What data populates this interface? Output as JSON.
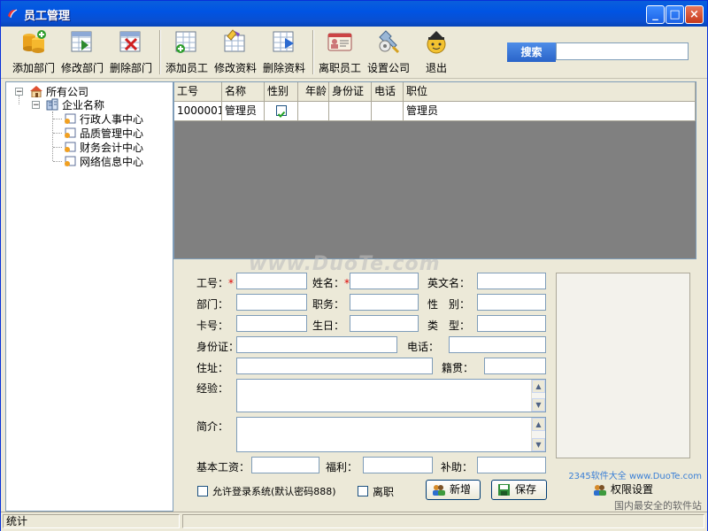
{
  "window": {
    "title": "员工管理"
  },
  "toolbar": {
    "buttons": [
      {
        "label": "添加部门",
        "icon": "add-dept-icon"
      },
      {
        "label": "修改部门",
        "icon": "edit-dept-icon"
      },
      {
        "label": "删除部门",
        "icon": "delete-dept-icon"
      },
      {
        "label": "添加员工",
        "icon": "add-employee-icon"
      },
      {
        "label": "修改资料",
        "icon": "edit-info-icon"
      },
      {
        "label": "删除资料",
        "icon": "delete-info-icon"
      },
      {
        "label": "离职员工",
        "icon": "resigned-employee-icon"
      },
      {
        "label": "设置公司",
        "icon": "company-settings-icon"
      },
      {
        "label": "退出",
        "icon": "exit-icon"
      }
    ],
    "search_label": "搜索",
    "search_value": ""
  },
  "tree": {
    "root": "所有公司",
    "company": "企业名称",
    "departments": [
      "行政人事中心",
      "品质管理中心",
      "财务会计中心",
      "网络信息中心"
    ]
  },
  "grid": {
    "columns": [
      "工号",
      "名称",
      "性别",
      "年龄",
      "身份证",
      "电话",
      "职位"
    ],
    "rows": [
      {
        "id": "1000001",
        "name": "管理员",
        "gender_checked": true,
        "age": "",
        "idcard": "",
        "phone": "",
        "position": "管理员"
      }
    ]
  },
  "form": {
    "labels": {
      "emp_no": "工号：",
      "name": "姓名：",
      "english_name": "英文名：",
      "dept": "部门：",
      "title": "职务：",
      "gender": "性　别：",
      "card": "卡号：",
      "birthday": "生日：",
      "type": "类　型：",
      "idcard": "身份证：",
      "phone": "电话：",
      "address": "住址：",
      "native": "籍贯：",
      "experience": "经验：",
      "intro": "简介：",
      "salary": "基本工资：",
      "welfare": "福利：",
      "subsidy": "补助："
    },
    "required_mark": "*",
    "allow_login_label": "允许登录系统(默认密码888)",
    "resigned_label": "离职",
    "add_button": "新增",
    "save_button": "保存",
    "permission_button": "权限设置"
  },
  "statusbar": {
    "text": "统计"
  },
  "watermarks": {
    "main": "www.DuoTe.com",
    "site": "2345软件大全 www.DuoTe.com",
    "slogan": "国内最安全的软件站"
  },
  "colors": {
    "titlebar": "#0054e3",
    "grid_bg": "#808080",
    "required": "#d00000",
    "search_label_bg": "#2a64c9"
  }
}
